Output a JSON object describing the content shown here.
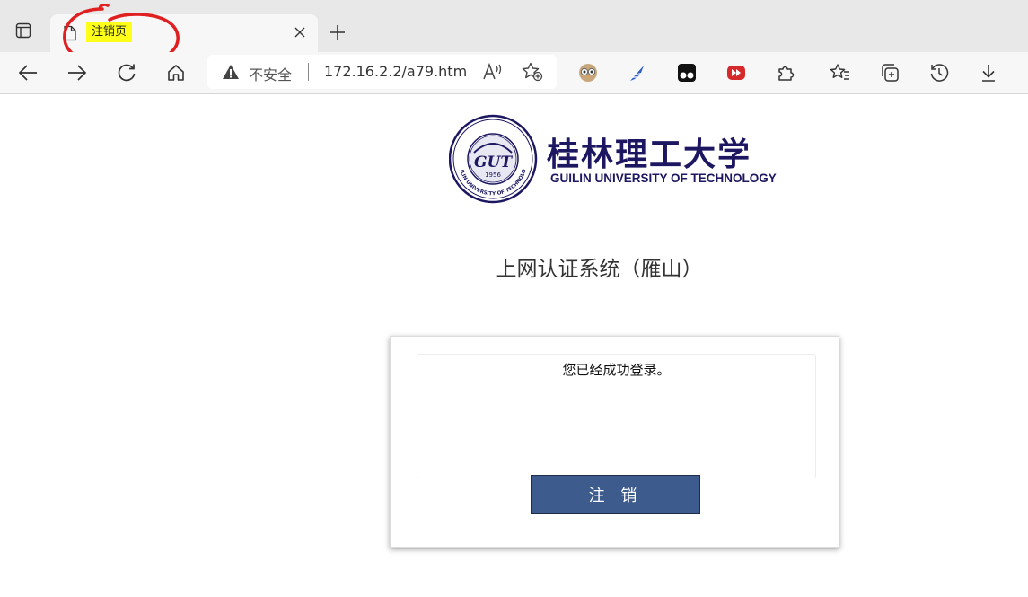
{
  "browser": {
    "tab": {
      "title": "注销页",
      "close_icon": "close-icon"
    },
    "address_bar": {
      "security_label": "不安全",
      "url": "172.16.2.2/a79.htm"
    },
    "highlight_color": "#ffff1a",
    "annotation_color": "#e02020"
  },
  "page": {
    "logo": {
      "chinese_name": "桂林理工大学",
      "english_name": "GUILIN UNIVERSITY OF TECHNOLOGY",
      "emblem_text": "GUILIN UNIVERSITY OF TECHNOLOGY",
      "emblem_year": "1956",
      "emblem_mark": "GUT"
    },
    "heading": "上网认证系统（雁山）",
    "status_message": "您已经成功登录。",
    "logout_button_label": "注 销",
    "accent_color": "#3e5b8e"
  }
}
